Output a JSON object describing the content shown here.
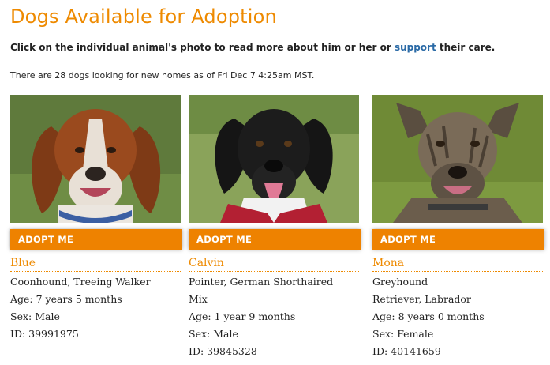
{
  "header": {
    "title": "Dogs Available for Adoption"
  },
  "intro": {
    "text_before": "Click on the individual animal's photo to read more about him or her or ",
    "link_label": "support",
    "text_after": " their care."
  },
  "summary": {
    "text": "There are 28 dogs looking for new homes as of Fri Dec 7 4:25am MST."
  },
  "adopt_label": "ADOPT ME",
  "dogs": [
    {
      "name": "Blue",
      "breed_lines": [
        "Coonhound, Treeing Walker"
      ],
      "age": "Age: 7 years 5 months",
      "sex": "Sex: Male",
      "id": "ID: 39991975",
      "colors": {
        "bg": "#5f7a3c",
        "coat": "#9a4a1e",
        "face": "#e8e0d6",
        "collar": "#3b5fa3"
      }
    },
    {
      "name": "Calvin",
      "breed_lines": [
        "Pointer, German Shorthaired",
        "Mix"
      ],
      "age": "Age: 1 year 9 months",
      "sex": "Sex: Male",
      "id": "ID: 39845328",
      "colors": {
        "bg": "#8aa35a",
        "coat": "#1c1c1c",
        "face": "#f2f2f2",
        "collar": "#b32033"
      }
    },
    {
      "name": "Mona",
      "breed_lines": [
        "Greyhound",
        "Retriever, Labrador"
      ],
      "age": "Age: 8 years 0 months",
      "sex": "Sex: Female",
      "id": "ID: 40141659",
      "colors": {
        "bg": "#6f8a36",
        "coat": "#7a6b58",
        "face": "#5e5244",
        "collar": "#3a3a3a"
      }
    }
  ]
}
